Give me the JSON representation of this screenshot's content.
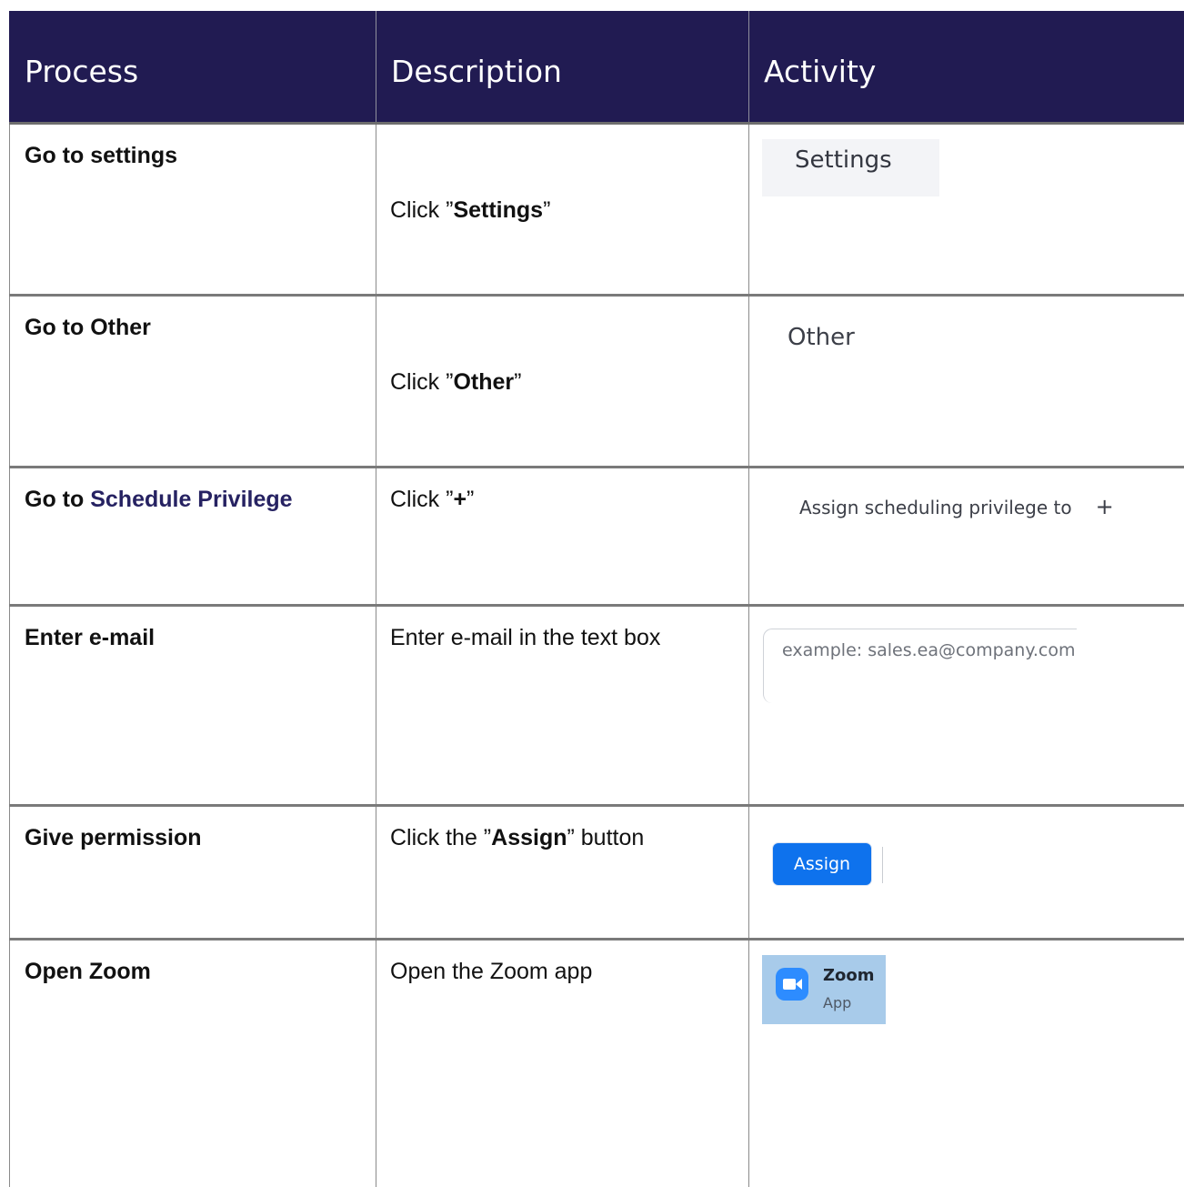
{
  "header": {
    "col_process": "Process",
    "col_description": "Description",
    "col_activity": "Activity"
  },
  "rows": [
    {
      "process": "Go to settings",
      "description": {
        "prefix": "Click ”",
        "bold": "Settings",
        "suffix": "”"
      },
      "activity": {
        "label": "Settings"
      }
    },
    {
      "process": "Go to Other",
      "description": {
        "prefix": "Click ”",
        "bold": "Other",
        "suffix": "”"
      },
      "activity": {
        "label": "Other"
      }
    },
    {
      "process_prefix": "Go to ",
      "process_highlight": "Schedule Privilege",
      "description": {
        "prefix": "Click ”",
        "bold": "+",
        "suffix": "”"
      },
      "activity": {
        "label": "Assign scheduling privilege to",
        "plus": "+"
      }
    },
    {
      "process": "Enter e-mail",
      "description": {
        "text": "Enter e-mail in the text box"
      },
      "activity": {
        "placeholder": "example: sales.ea@company.com,"
      }
    },
    {
      "process": "Give permission",
      "description": {
        "prefix": "Click the ”",
        "bold": "Assign",
        "suffix": "” button"
      },
      "activity": {
        "button_label": "Assign"
      }
    },
    {
      "process": "Open Zoom",
      "description": {
        "text": "Open the Zoom app"
      },
      "activity": {
        "app_name": "Zoom",
        "app_sub": "App"
      }
    }
  ],
  "colors": {
    "header_bg": "#211b52",
    "header_text": "#ffffff",
    "assign_button": "#0e72ed",
    "zoom_tile": "#a8cbea",
    "zoom_icon": "#2d8cff"
  }
}
